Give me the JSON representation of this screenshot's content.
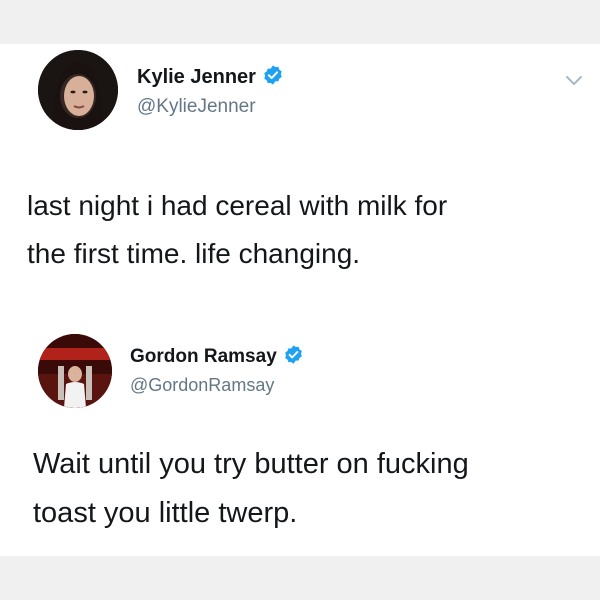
{
  "tweets": [
    {
      "author_name": "Kylie Jenner",
      "handle": "@KylieJenner",
      "verified": true,
      "lines": [
        "last night i had cereal with milk for",
        "the first time. life changing."
      ]
    },
    {
      "author_name": "Gordon Ramsay",
      "handle": "@GordonRamsay",
      "verified": true,
      "lines": [
        "Wait until you try butter on fucking",
        "toast you little twerp."
      ]
    }
  ],
  "icons": {
    "verified": "verified-badge-icon",
    "menu": "chevron-down-icon"
  },
  "colors": {
    "verified_blue": "#1da1f2",
    "text": "#14171a",
    "secondary": "#657786"
  }
}
